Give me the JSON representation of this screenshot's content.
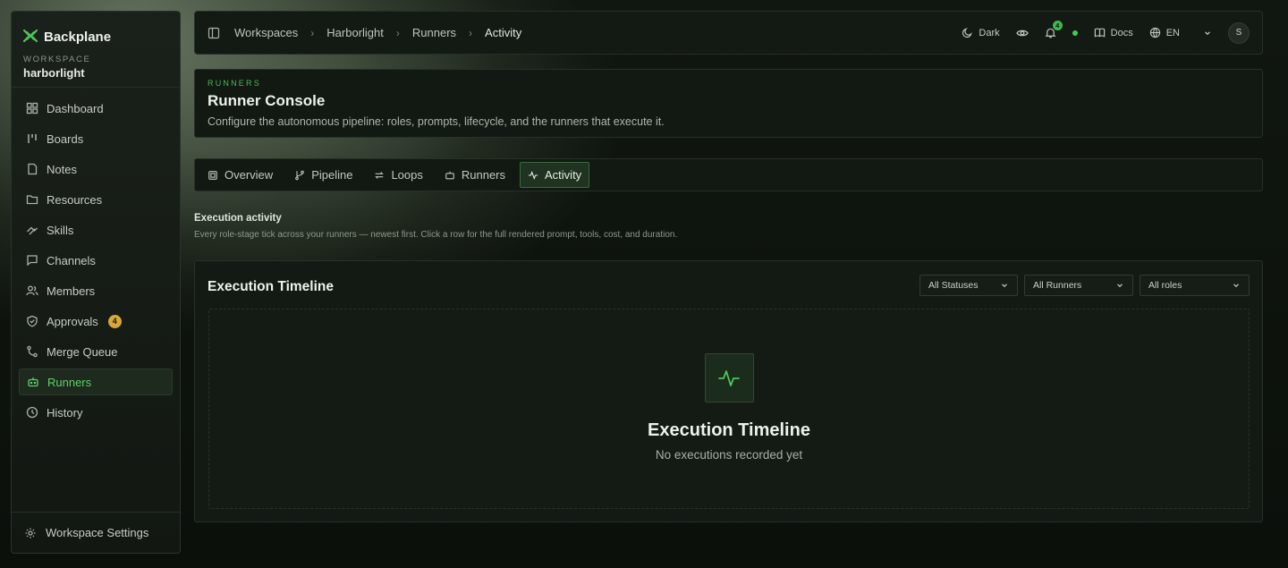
{
  "sidebar": {
    "brand": "Backplane",
    "workspace_label": "WORKSPACE",
    "workspace_name": "harborlight",
    "items": [
      {
        "label": "Dashboard"
      },
      {
        "label": "Boards"
      },
      {
        "label": "Notes"
      },
      {
        "label": "Resources"
      },
      {
        "label": "Skills"
      },
      {
        "label": "Channels"
      },
      {
        "label": "Members"
      },
      {
        "label": "Approvals",
        "badge": "4"
      },
      {
        "label": "Merge Queue"
      },
      {
        "label": "Runners"
      },
      {
        "label": "History"
      }
    ],
    "active_item": "Runners",
    "footer": "Workspace Settings"
  },
  "topbar": {
    "breadcrumbs": [
      "Workspaces",
      "Harborlight",
      "Runners",
      "Activity"
    ],
    "theme": "Dark",
    "notification_count": "4",
    "docs": "Docs",
    "language": "EN",
    "avatar_initial": "S"
  },
  "header": {
    "eyebrow": "RUNNERS",
    "title": "Runner Console",
    "description": "Configure the autonomous pipeline: roles, prompts, lifecycle, and the runners that execute it."
  },
  "tabs": [
    {
      "label": "Overview"
    },
    {
      "label": "Pipeline"
    },
    {
      "label": "Loops"
    },
    {
      "label": "Runners"
    },
    {
      "label": "Activity"
    }
  ],
  "active_tab": "Activity",
  "section": {
    "title": "Execution activity",
    "subtitle": "Every role-stage tick across your runners — newest first. Click a row for the full rendered prompt, tools, cost, and duration."
  },
  "timeline": {
    "title": "Execution Timeline",
    "filters": {
      "status": "All Statuses",
      "runners": "All Runners",
      "roles": "All roles"
    },
    "empty_title": "Execution Timeline",
    "empty_subtitle": "No executions recorded yet"
  },
  "colors": {
    "accent": "#4fc45c",
    "background": "#0f150f",
    "badge": "#d8a73a"
  }
}
